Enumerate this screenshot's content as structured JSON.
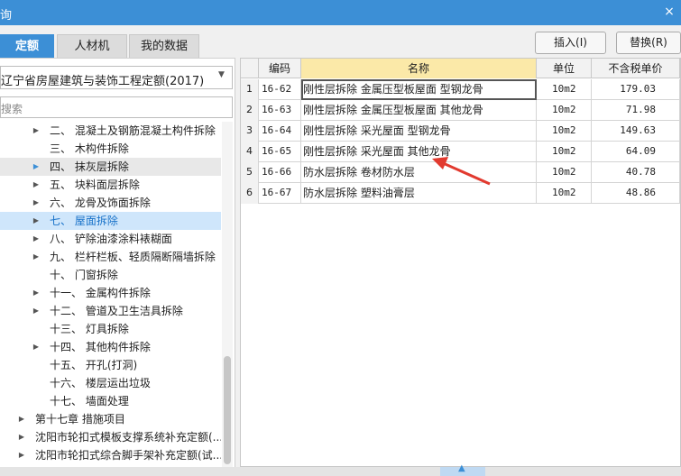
{
  "window": {
    "title": "询",
    "close_glyph": "×"
  },
  "tabs": [
    {
      "label": "定额",
      "active": true
    },
    {
      "label": "人材机",
      "active": false
    },
    {
      "label": "我的数据",
      "active": false
    }
  ],
  "buttons": {
    "insert": "插入(I)",
    "replace": "替换(R)"
  },
  "left": {
    "quota_library": "辽宁省房屋建筑与装饰工程定额(2017)",
    "search_placeholder": "搜索",
    "tree": [
      {
        "label": "二、 混凝土及钢筋混凝土构件拆除",
        "expander": "▶",
        "state": "normal"
      },
      {
        "label": "三、 木构件拆除",
        "expander": "",
        "state": "normal"
      },
      {
        "label": "四、 抹灰层拆除",
        "expander": "▶",
        "state": "hover"
      },
      {
        "label": "五、 块料面层拆除",
        "expander": "▶",
        "state": "normal"
      },
      {
        "label": "六、 龙骨及饰面拆除",
        "expander": "▶",
        "state": "normal"
      },
      {
        "label": "七、 屋面拆除",
        "expander": "▶",
        "state": "selected"
      },
      {
        "label": "八、 铲除油漆涂料裱糊面",
        "expander": "▶",
        "state": "normal"
      },
      {
        "label": "九、 栏杆栏板、轻质隔断隔墙拆除",
        "expander": "▶",
        "state": "normal"
      },
      {
        "label": "十、 门窗拆除",
        "expander": "",
        "state": "normal"
      },
      {
        "label": "十一、 金属构件拆除",
        "expander": "▶",
        "state": "normal"
      },
      {
        "label": "十二、 管道及卫生洁具拆除",
        "expander": "▶",
        "state": "normal"
      },
      {
        "label": "十三、 灯具拆除",
        "expander": "",
        "state": "normal"
      },
      {
        "label": "十四、 其他构件拆除",
        "expander": "▶",
        "state": "normal"
      },
      {
        "label": "十五、 开孔(打洞)",
        "expander": "",
        "state": "normal"
      },
      {
        "label": "十六、 楼层运出垃圾",
        "expander": "",
        "state": "normal"
      },
      {
        "label": "十七、 墙面处理",
        "expander": "",
        "state": "normal"
      },
      {
        "label": "第十七章 措施项目",
        "expander": "▶",
        "state": "normal"
      },
      {
        "label": "沈阳市轮扣式模板支撑系统补充定额(...",
        "expander": "▶",
        "state": "normal"
      },
      {
        "label": "沈阳市轮扣式综合脚手架补充定额(试...",
        "expander": "▶",
        "state": "normal"
      }
    ]
  },
  "grid": {
    "columns": {
      "code": "编码",
      "name": "名称",
      "unit": "单位",
      "price": "不含税单价"
    },
    "rows": [
      {
        "idx": "1",
        "code": "16-62",
        "name": "刚性层拆除 金属压型板屋面 型钢龙骨",
        "unit": "10m2",
        "price": "179.03"
      },
      {
        "idx": "2",
        "code": "16-63",
        "name": "刚性层拆除 金属压型板屋面 其他龙骨",
        "unit": "10m2",
        "price": "71.98"
      },
      {
        "idx": "3",
        "code": "16-64",
        "name": "刚性层拆除 采光屋面 型钢龙骨",
        "unit": "10m2",
        "price": "149.63"
      },
      {
        "idx": "4",
        "code": "16-65",
        "name": "刚性层拆除 采光屋面 其他龙骨",
        "unit": "10m2",
        "price": "64.09"
      },
      {
        "idx": "5",
        "code": "16-66",
        "name": "防水层拆除 卷材防水层",
        "unit": "10m2",
        "price": "40.78"
      },
      {
        "idx": "6",
        "code": "16-67",
        "name": "防水层拆除 塑料油膏层",
        "unit": "10m2",
        "price": "48.86"
      }
    ]
  },
  "colors": {
    "accent": "#3c8fd6",
    "name_header": "#fbe9a8",
    "annotation_arrow": "#e23a2f"
  }
}
